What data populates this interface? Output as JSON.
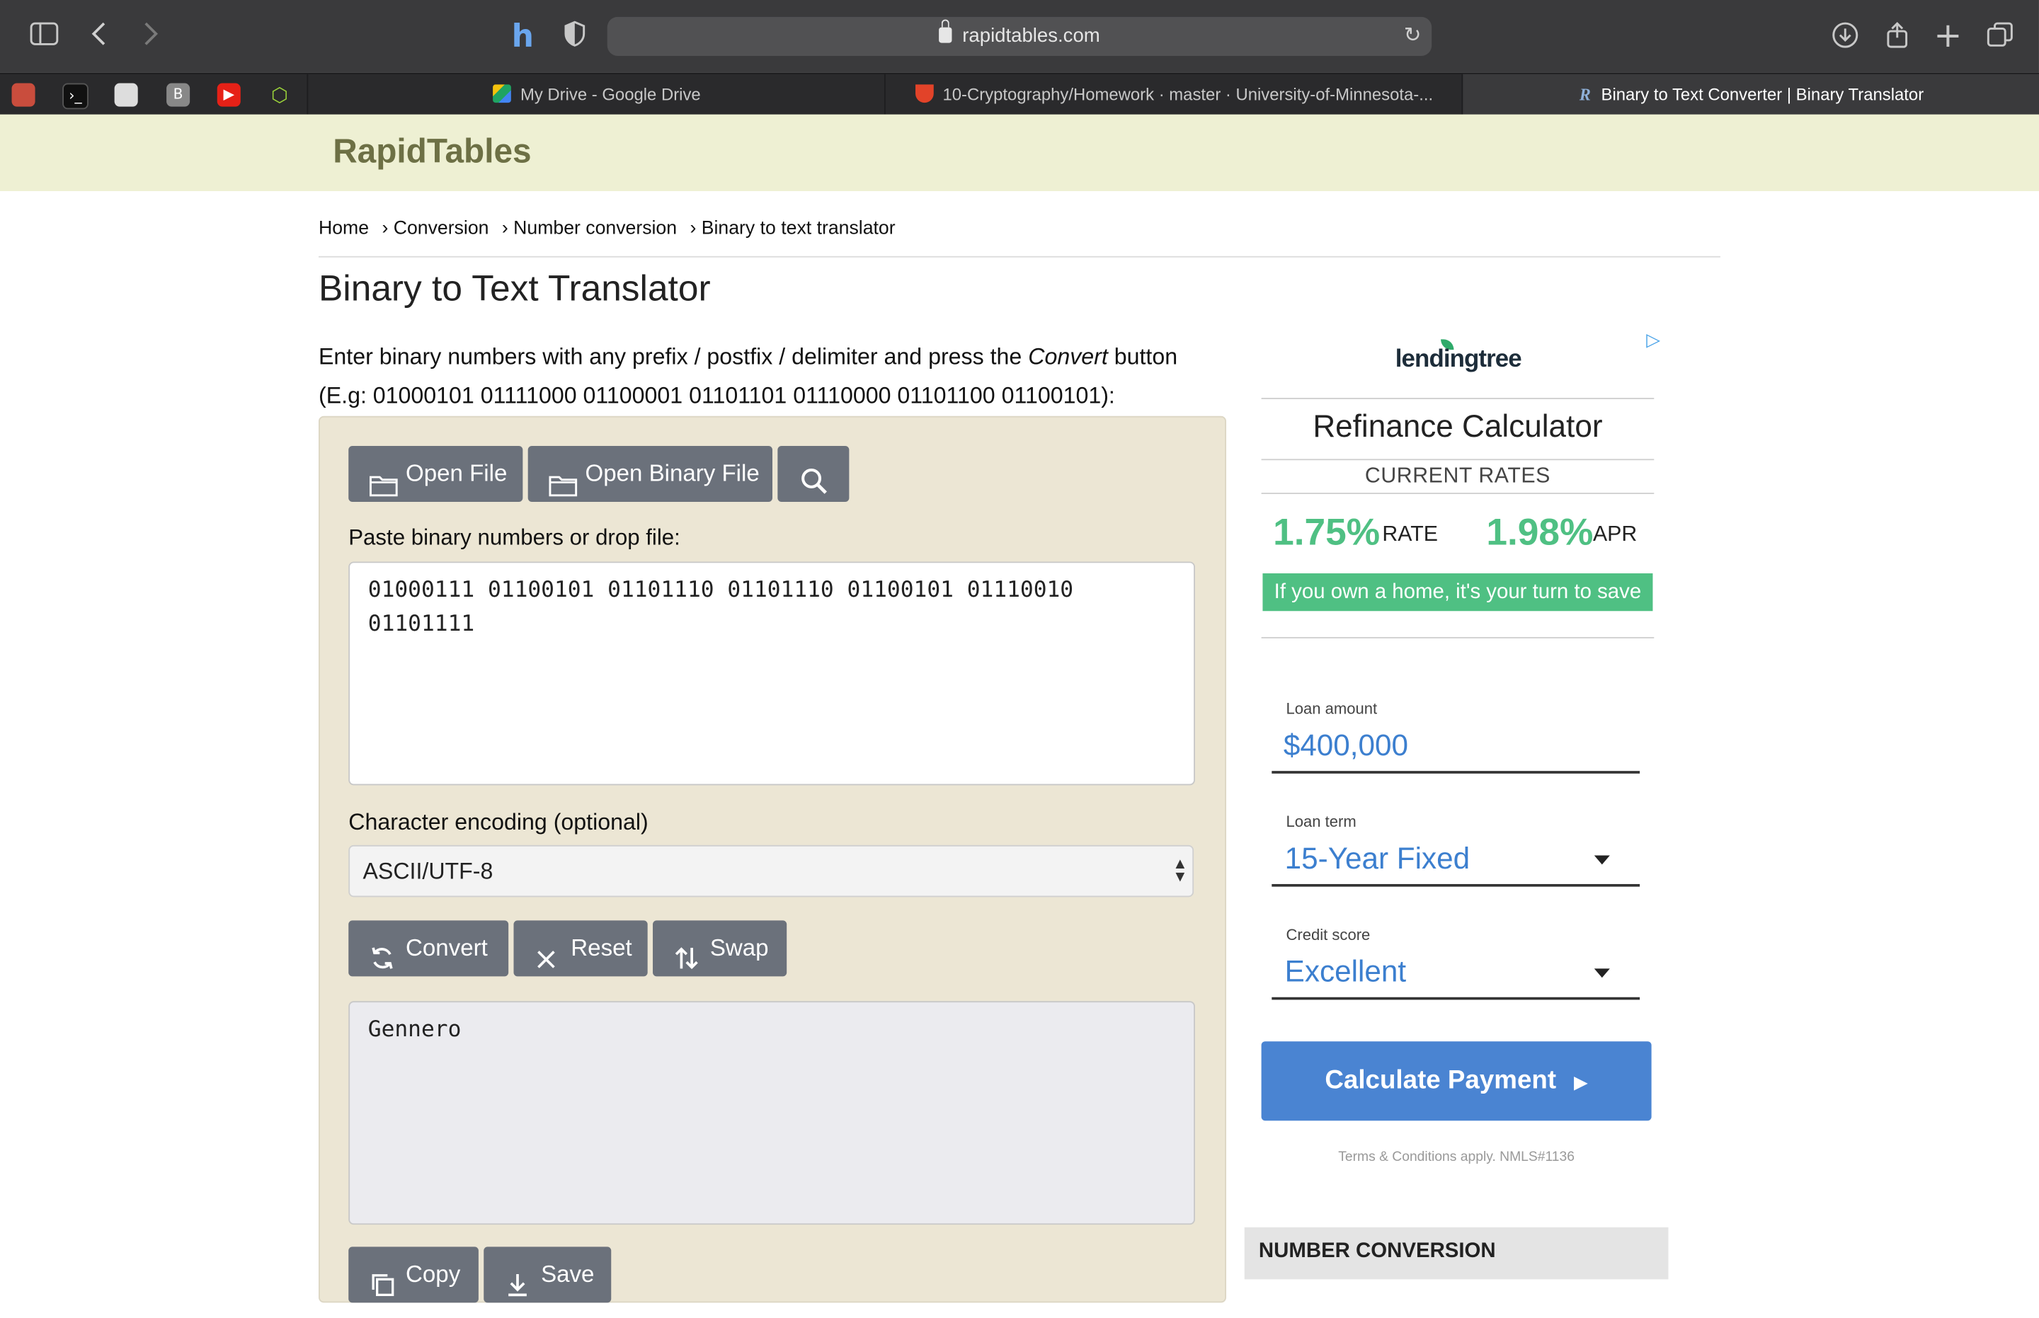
{
  "browser": {
    "url": "rapidtables.com",
    "tabs": [
      {
        "label": "My Drive - Google Drive"
      },
      {
        "label": "10-Cryptography/Homework · master · University-of-Minnesota-..."
      },
      {
        "label": "Binary to Text Converter | Binary Translator"
      }
    ],
    "pinned_tab_letter": "B"
  },
  "site": {
    "logo": "RapidTables",
    "breadcrumb": [
      "Home",
      "› Conversion",
      "› Number conversion",
      "› Binary to text translator"
    ],
    "title": "Binary to Text Translator",
    "intro_before": "Enter binary numbers with any prefix / postfix / delimiter and press the ",
    "intro_em": "Convert",
    "intro_after": " button",
    "intro_example": "(E.g: 01000101 01111000 01100001 01101101 01110000 01101100 01100101):"
  },
  "tool": {
    "open_file": "Open File",
    "open_binary_file": "Open Binary File",
    "paste_label": "Paste binary numbers or drop file:",
    "input_value": "01000111 01100101 01101110 01101110 01100101 01110010\n01101111",
    "encoding_label": "Character encoding (optional)",
    "encoding_value": "ASCII/UTF-8",
    "convert": "Convert",
    "reset": "Reset",
    "swap": "Swap",
    "output_value": "Gennero",
    "copy": "Copy",
    "save": "Save"
  },
  "ad": {
    "brand": "lendingtree",
    "title": "Refinance Calculator",
    "subtitle": "CURRENT RATES",
    "rate_value": "1.75%",
    "rate_label": "RATE",
    "apr_value": "1.98%",
    "apr_label": "APR",
    "banner": "If you own a home, it's your turn to save",
    "loan_amount_label": "Loan amount",
    "loan_amount_value": "$400,000",
    "loan_term_label": "Loan term",
    "loan_term_value": "15-Year Fixed",
    "credit_label": "Credit score",
    "credit_value": "Excellent",
    "cta": "Calculate Payment",
    "terms": "Terms & Conditions apply. NMLS#1136"
  },
  "sidebar": {
    "section_title": "NUMBER CONVERSION"
  },
  "colors": {
    "header_bg": "#eef0d3",
    "panel_bg": "#ece6d4",
    "button_bg": "#6b717b",
    "ad_green": "#4fc083",
    "ad_blue": "#4a84d2"
  }
}
